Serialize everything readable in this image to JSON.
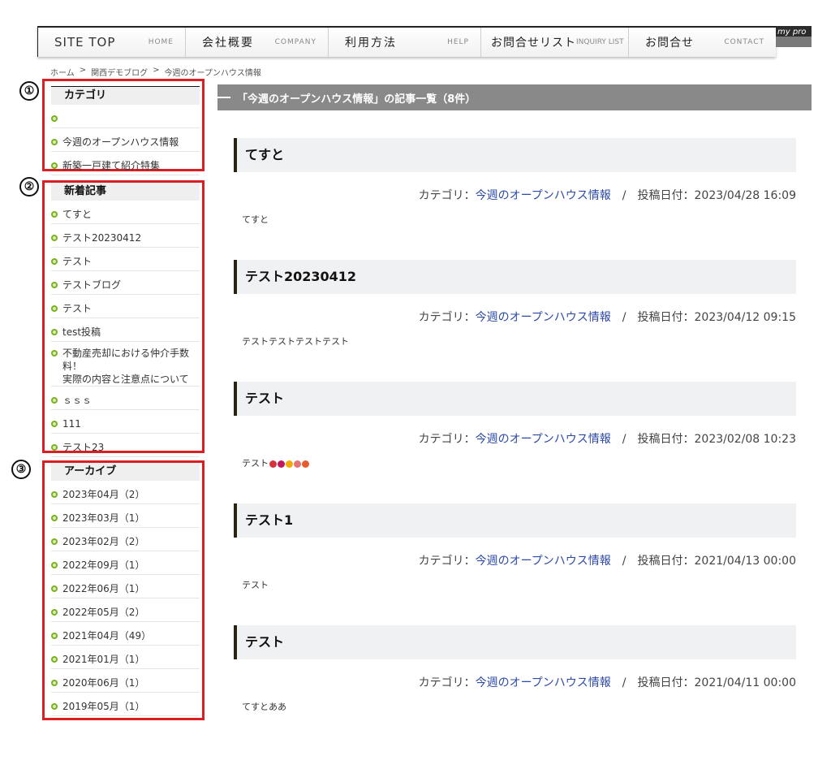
{
  "nav": [
    {
      "key": "siteTop",
      "ja": "SITE TOP",
      "en": "HOME"
    },
    {
      "key": "company",
      "ja": "会社概要",
      "en": "COMPANY"
    },
    {
      "key": "help",
      "ja": "利用方法",
      "en": "HELP"
    },
    {
      "key": "inquiry",
      "ja": "お問合せリスト",
      "en": "INQUIRY LIST"
    },
    {
      "key": "contact",
      "ja": "お問合せ",
      "en": "CONTACT"
    }
  ],
  "brand_text": "my pro",
  "breadcrumb": {
    "home": "ホーム",
    "blog": "関西デモブログ",
    "current": "今週のオープンハウス情報",
    "sep": ">"
  },
  "markers": [
    "①",
    "②",
    "③"
  ],
  "sidebar": {
    "category": {
      "title": "カテゴリ",
      "items": [
        "",
        "今週のオープンハウス情報",
        "新築一戸建て紹介特集"
      ]
    },
    "recent": {
      "title": "新着記事",
      "items": [
        "てすと",
        "テスト20230412",
        "テスト",
        "テストブログ",
        "テスト",
        "test投稿",
        "不動産売却における仲介手数料！\n実際の内容と注意点について",
        "ｓｓｓ",
        "111",
        "テスト23"
      ]
    },
    "archive": {
      "title": "アーカイブ",
      "items": [
        "2023年04月（2）",
        "2023年03月（1）",
        "2023年02月（2）",
        "2022年09月（1）",
        "2022年06月（1）",
        "2022年05月（2）",
        "2021年04月（49）",
        "2021年01月（1）",
        "2020年06月（1）",
        "2019年05月（1）"
      ]
    }
  },
  "main": {
    "heading": "「今週のオープンハウス情報」の記事一覧（8件）",
    "meta_category_label": "カテゴリ：",
    "meta_date_label": "投稿日付：",
    "meta_sep": "/",
    "posts": [
      {
        "title": "てすと",
        "category": "今週のオープンハウス情報",
        "date": "2023/04/28 16:09",
        "body": "てすと"
      },
      {
        "title": "テスト20230412",
        "category": "今週のオープンハウス情報",
        "date": "2023/04/12 09:15",
        "body": "テストテストテストテスト"
      },
      {
        "title": "テスト",
        "category": "今週のオープンハウス情報",
        "date": "2023/02/08 10:23",
        "body": "テスト"
      },
      {
        "title": "テスト1",
        "category": "今週のオープンハウス情報",
        "date": "2021/04/13 00:00",
        "body": "テスト"
      },
      {
        "title": "テスト",
        "category": "今週のオープンハウス情報",
        "date": "2021/04/11 00:00",
        "body": "てすとああ"
      }
    ]
  },
  "colors": {
    "accent_red": "#d71f24",
    "bullet_green": "#7bb21f",
    "link_blue": "#2d4aa8",
    "heading_gray": "#898989"
  }
}
